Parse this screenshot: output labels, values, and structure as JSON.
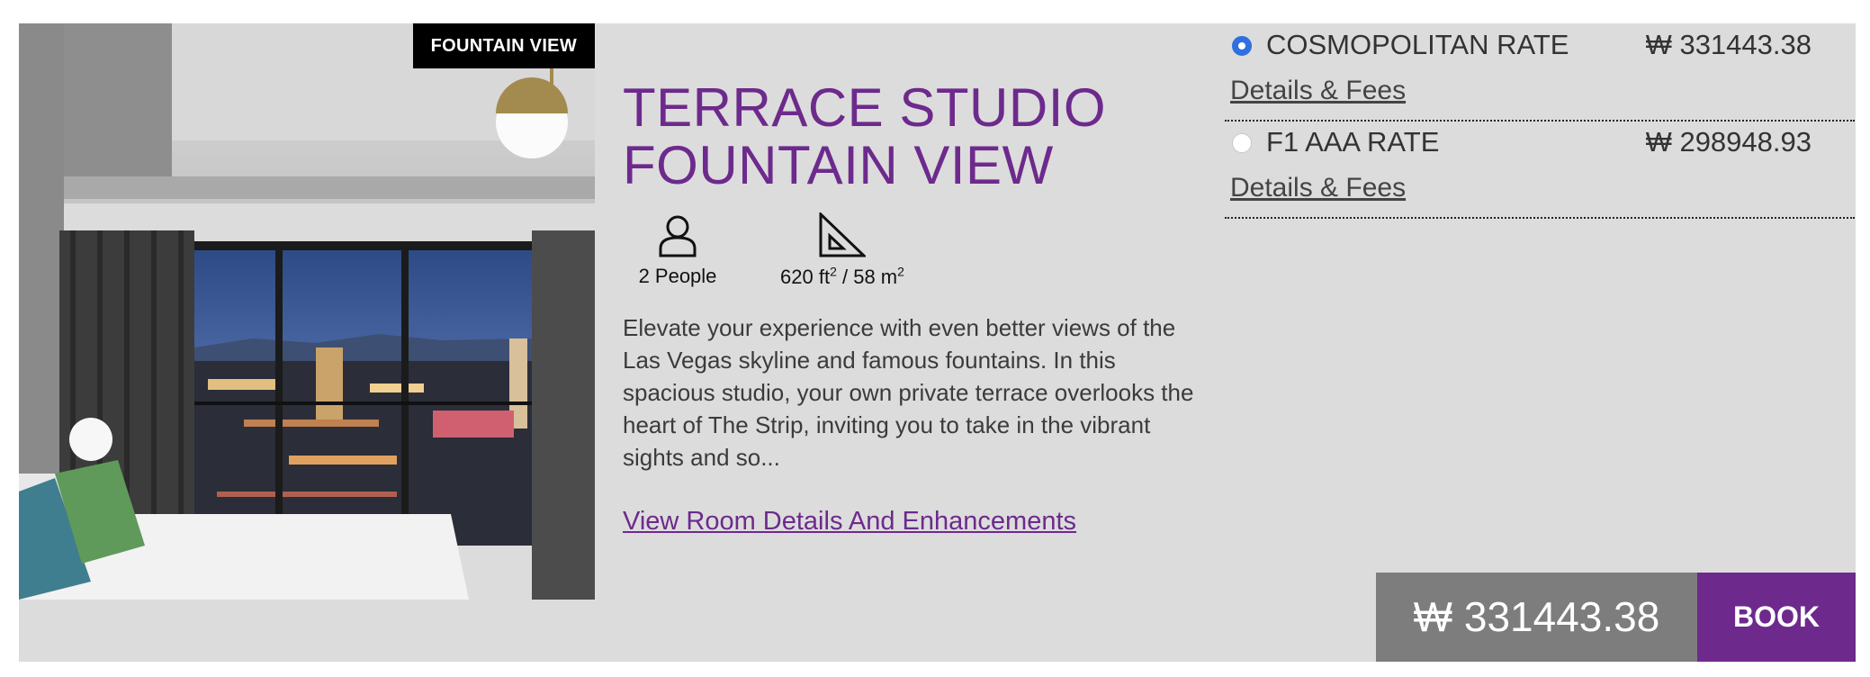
{
  "room": {
    "image_badge": "FOUNTAIN VIEW",
    "title_line1": "TERRACE STUDIO",
    "title_line2": "FOUNTAIN VIEW",
    "occupancy": "2 People",
    "size_ft": "620 ft",
    "size_sep": " / 58 m",
    "sup": "2",
    "description": "Elevate your experience with even better views of the Las Vegas skyline and famous fountains. In this spacious studio, your own private terrace overlooks the heart of The Strip, inviting you to take in the vibrant sights and so...",
    "details_link": "View Room Details And Enhancements"
  },
  "rates": [
    {
      "name": "COSMOPOLITAN RATE",
      "price": "₩ 331443.38",
      "fees_link": "Details & Fees",
      "selected": true
    },
    {
      "name": "F1 AAA RATE",
      "price": "₩ 298948.93",
      "fees_link": "Details & Fees",
      "selected": false
    }
  ],
  "booking": {
    "total_price": "₩ 331443.38",
    "book_label": "BOOK"
  },
  "colors": {
    "accent": "#6d2a8c",
    "card_background": "#dcdcdc",
    "price_box": "#7d7d7d",
    "radio_selected": "#2f6fe0"
  },
  "icons": {
    "occupancy": "person-icon",
    "size": "set-square-icon"
  }
}
